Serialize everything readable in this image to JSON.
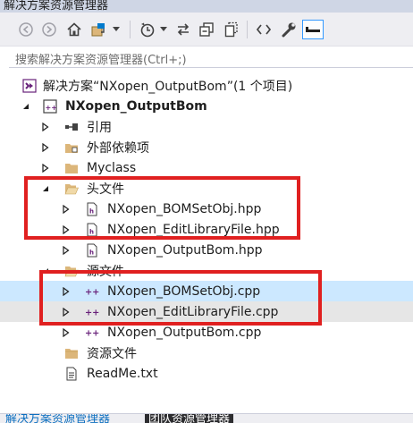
{
  "window": {
    "title": "解决方案资源管理器"
  },
  "toolbar": {
    "buttons": [
      {
        "icon": "back-icon"
      },
      {
        "icon": "forward-icon"
      },
      {
        "icon": "home-icon"
      },
      {
        "icon": "switch-views-icon"
      },
      {
        "icon": "dropdown-arrow-icon"
      },
      {
        "icon": "pending-changes-icon"
      },
      {
        "icon": "dropdown-arrow-icon"
      },
      {
        "icon": "sync-icon"
      },
      {
        "icon": "collapse-all-icon"
      },
      {
        "icon": "show-all-files-icon"
      },
      {
        "icon": "view-code-icon"
      },
      {
        "icon": "properties-wrench-icon"
      },
      {
        "icon": "preview-selected-icon"
      }
    ]
  },
  "search": {
    "placeholder": "搜索解决方案资源管理器(Ctrl+;)"
  },
  "tree": {
    "solution": {
      "label": "解决方案“NXopen_OutputBom”(1 个项目)",
      "icon": "solution-icon"
    },
    "project": {
      "label": "NXopen_OutputBom",
      "icon": "cpp-project-icon"
    },
    "items": [
      {
        "label": "引用",
        "icon": "references-icon",
        "expander": "collapsed"
      },
      {
        "label": "外部依赖项",
        "icon": "external-dependencies-icon",
        "expander": "collapsed"
      },
      {
        "label": "Myclass",
        "icon": "folder-icon",
        "expander": "collapsed"
      },
      {
        "label": "头文件",
        "icon": "filter-folder-open-icon",
        "expander": "expanded"
      },
      {
        "label": "NXopen_BOMSetObj.hpp",
        "icon": "header-file-icon",
        "expander": "collapsed"
      },
      {
        "label": "NXopen_EditLibraryFile.hpp",
        "icon": "header-file-icon",
        "expander": "collapsed"
      },
      {
        "label": "NXopen_OutputBom.hpp",
        "icon": "header-file-icon",
        "expander": "collapsed"
      },
      {
        "label": "源文件",
        "icon": "filter-folder-open-icon",
        "expander": "expanded"
      },
      {
        "label": "NXopen_BOMSetObj.cpp",
        "icon": "cpp-file-icon",
        "expander": "collapsed"
      },
      {
        "label": "NXopen_EditLibraryFile.cpp",
        "icon": "cpp-file-icon",
        "expander": "collapsed"
      },
      {
        "label": "NXopen_OutputBom.cpp",
        "icon": "cpp-file-icon",
        "expander": "collapsed"
      },
      {
        "label": "资源文件",
        "icon": "filter-folder-icon",
        "expander": "none"
      },
      {
        "label": "ReadMe.txt",
        "icon": "text-file-icon",
        "expander": "none"
      }
    ]
  },
  "bottom_tabs": [
    {
      "label": "解决方案资源管理器"
    },
    {
      "label": "团队资源管理器"
    }
  ],
  "colors": {
    "selected_row": "#cce8ff",
    "hover_row": "#e6e6e6",
    "highlight_box": "#e02020",
    "accent": "#007acc",
    "folder": "#dcb67a",
    "cpp_icon": "#68217a"
  }
}
